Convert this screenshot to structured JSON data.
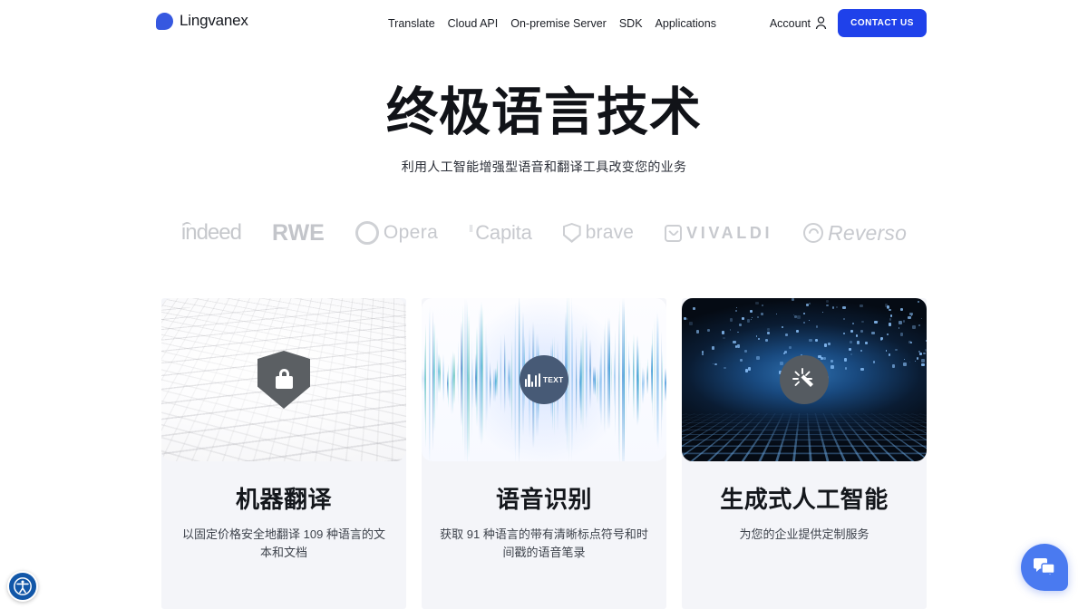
{
  "header": {
    "brand": "Lingvanex",
    "brand_mark_color": "#3658e0",
    "nav": [
      {
        "label": "Translate"
      },
      {
        "label": "Cloud API"
      },
      {
        "label": "On-premise Server"
      },
      {
        "label": "SDK"
      },
      {
        "label": "Applications"
      }
    ],
    "account_label": "Account",
    "contact_label": "CONTACT US",
    "contact_color": "#1f41ea"
  },
  "hero": {
    "title": "终极语言技术",
    "subtitle": "利用人工智能增强型语音和翻译工具改变您的业务"
  },
  "logos": [
    {
      "name": "indeed",
      "label": "indeed"
    },
    {
      "name": "rwe",
      "label": "RWE"
    },
    {
      "name": "opera",
      "label": "Opera"
    },
    {
      "name": "capita",
      "label": "Capita"
    },
    {
      "name": "brave",
      "label": "brave"
    },
    {
      "name": "vivaldi",
      "label": "VIVALDI"
    },
    {
      "name": "reverso",
      "label": "Reverso"
    }
  ],
  "cards": [
    {
      "title": "机器翻译",
      "desc": "以固定价格安全地翻译 109 种语言的文本和文档",
      "icon": "shield-lock-icon",
      "image_alt": "data-letters-texture"
    },
    {
      "title": "语音识别",
      "desc": "获取 91 种语言的带有清晰标点符号和时间戳的语音笔录",
      "icon": "speech-to-text-icon",
      "badge_label": "TEXT",
      "image_alt": "audio-waveform"
    },
    {
      "title": "生成式人工智能",
      "desc": "为您的企业提供定制服务",
      "icon": "magic-wand-icon",
      "image_alt": "digital-grid"
    }
  ],
  "widgets": {
    "accessibility": "accessibility-icon",
    "chat": "chat-bubble-icon"
  }
}
